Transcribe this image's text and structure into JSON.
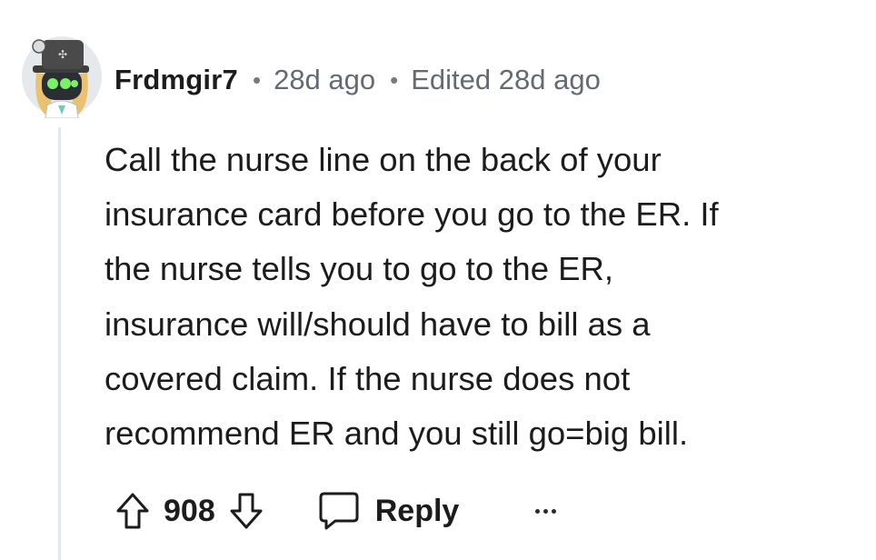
{
  "comment": {
    "author": "Frdmgir7",
    "separator": "•",
    "age": "28d ago",
    "edited": "Edited 28d ago",
    "body": "Call the nurse line on the back of your\ninsurance card before you go to the ER. If\nthe nurse tells you to go to the ER,\ninsurance will/should have to bill as a\ncovered claim. If the nurse does not\nrecommend ER and you still go=big bill.",
    "score": "908",
    "reply_label": "Reply"
  },
  "icons": {
    "avatar": "avatar-robot-icon",
    "upvote": "upvote-arrow-icon",
    "downvote": "downvote-arrow-icon",
    "reply": "speech-bubble-icon",
    "more": "more-dots-icon"
  },
  "colors": {
    "text": "#1c1c1c",
    "meta": "#636a72",
    "thread_line": "#e5e8ea",
    "avatar_hat": "#4a4a4a",
    "avatar_eyes": "#7cf06a"
  }
}
